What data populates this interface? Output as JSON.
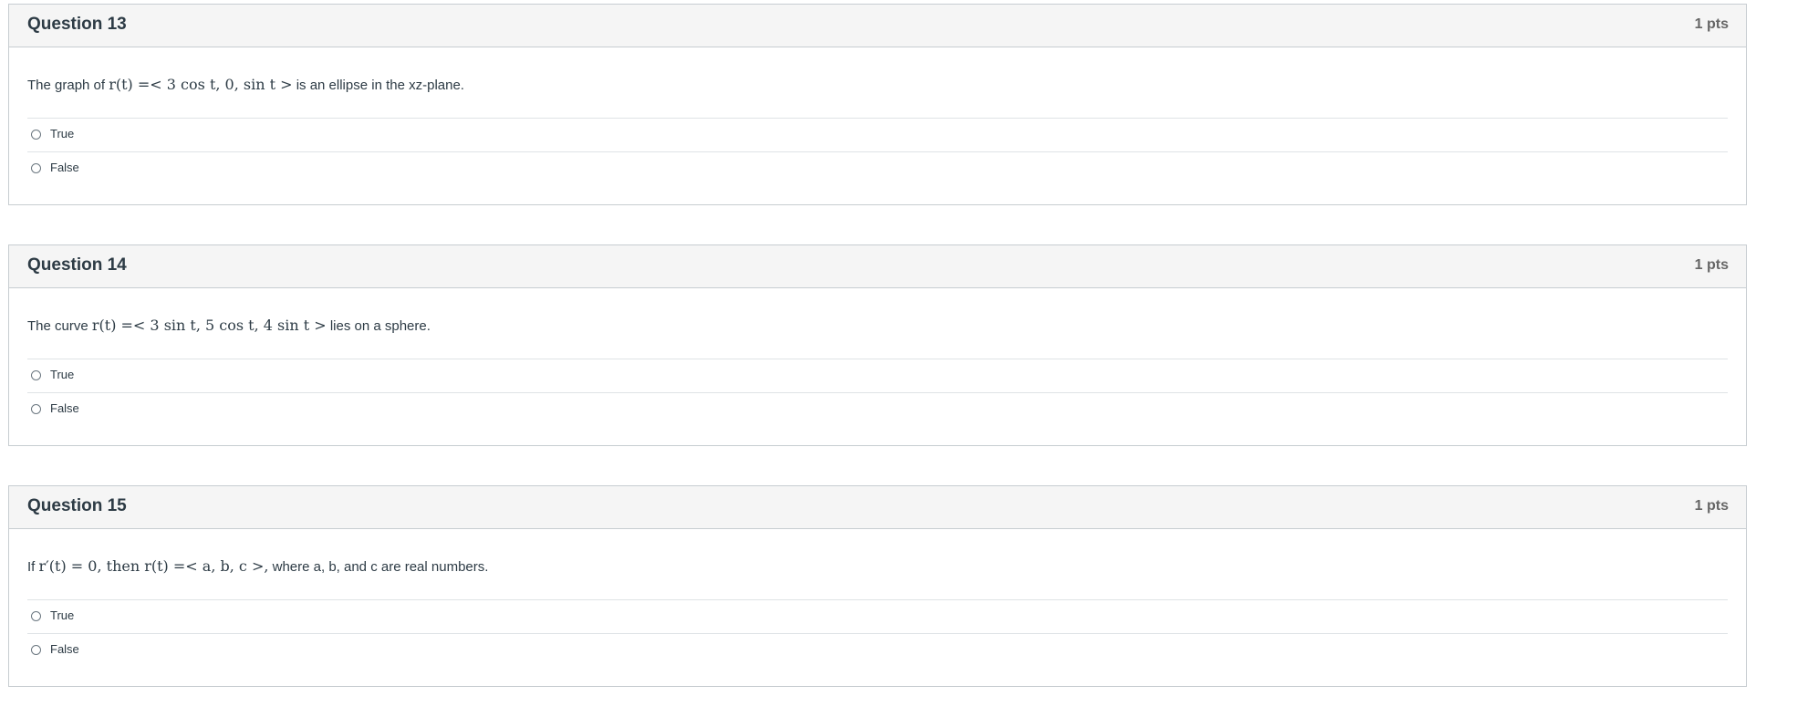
{
  "questions": [
    {
      "title": "Question 13",
      "points": "1 pts",
      "text_before": "The graph of ",
      "math": "r(t) =< 3 cos t, 0, sin t >",
      "text_after": " is an ellipse in the xz-plane.",
      "answers": [
        "True",
        "False"
      ]
    },
    {
      "title": "Question 14",
      "points": "1 pts",
      "text_before": "The curve ",
      "math": "r(t) =< 3 sin t, 5 cos t, 4 sin t >",
      "text_after": " lies on a sphere.",
      "answers": [
        "True",
        "False"
      ]
    },
    {
      "title": "Question 15",
      "points": "1 pts",
      "text_before": "If ",
      "math": "r′(t) = 0, then r(t) =< a, b, c >,",
      "text_after": " where a, b,  and c are real numbers.",
      "answers": [
        "True",
        "False"
      ]
    }
  ]
}
